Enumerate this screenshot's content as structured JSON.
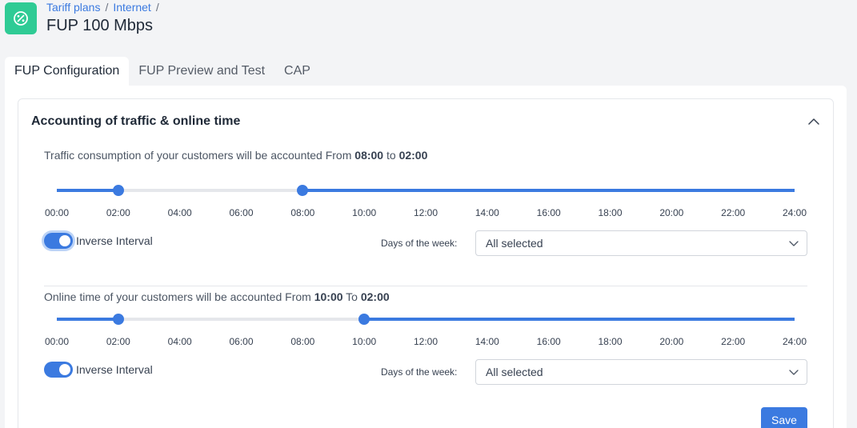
{
  "breadcrumb": {
    "items": [
      "Tariff plans",
      "Internet"
    ],
    "sep": "/"
  },
  "page_title": "FUP 100 Mbps",
  "tabs": [
    {
      "label": "FUP Configuration",
      "active": true
    },
    {
      "label": "FUP Preview and Test",
      "active": false
    },
    {
      "label": "CAP",
      "active": false
    }
  ],
  "card": {
    "title": "Accounting of traffic & online time"
  },
  "traffic": {
    "text_prefix": "Traffic consumption of your customers will be accounted From",
    "from": "08:00",
    "connector": "to",
    "to": "02:00",
    "handle_low_hours": 2,
    "handle_high_hours": 8,
    "inverse_label": "Inverse Interval",
    "inverse_on": true,
    "days_label": "Days of the week:",
    "days_value": "All selected"
  },
  "online": {
    "text_prefix": "Online time of your customers will be accounted From",
    "from": "10:00",
    "connector": "To",
    "to": "02:00",
    "handle_low_hours": 2,
    "handle_high_hours": 10,
    "inverse_label": "Inverse Interval",
    "inverse_on": true,
    "days_label": "Days of the week:",
    "days_value": "All selected"
  },
  "axis_ticks": [
    "00:00",
    "02:00",
    "04:00",
    "06:00",
    "08:00",
    "10:00",
    "12:00",
    "14:00",
    "16:00",
    "18:00",
    "20:00",
    "22:00",
    "24:00"
  ],
  "save_label": "Save",
  "colors": {
    "accent": "#3b7ae0",
    "app_icon": "#2fcb95"
  },
  "icons": {
    "app": "percent-circle-icon",
    "collapse": "chevron-up-icon",
    "select": "chevron-down-icon"
  }
}
